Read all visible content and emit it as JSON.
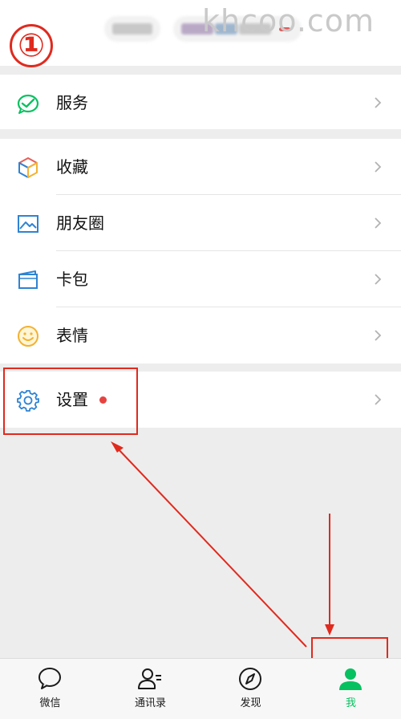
{
  "top": {
    "step_marker": "①",
    "watermark": "khcoo.com"
  },
  "menu": {
    "services": {
      "label": "服务",
      "icon": "wechat-pay-check-icon"
    },
    "favorites": {
      "label": "收藏",
      "icon": "cube-icon"
    },
    "moments": {
      "label": "朋友圈",
      "icon": "image-icon"
    },
    "cards": {
      "label": "卡包",
      "icon": "wallet-icon"
    },
    "stickers": {
      "label": "表情",
      "icon": "smile-icon"
    },
    "settings": {
      "label": "设置",
      "icon": "gear-icon",
      "has_badge": true
    }
  },
  "tabbar": {
    "tabs": [
      {
        "label": "微信",
        "icon": "chat-bubble-icon"
      },
      {
        "label": "通讯录",
        "icon": "contacts-icon"
      },
      {
        "label": "发现",
        "icon": "compass-icon"
      },
      {
        "label": "我",
        "icon": "person-icon",
        "active": true
      }
    ]
  },
  "colors": {
    "accent_green": "#07c160",
    "annotation_red": "#e02a1e",
    "background": "#ededed"
  }
}
